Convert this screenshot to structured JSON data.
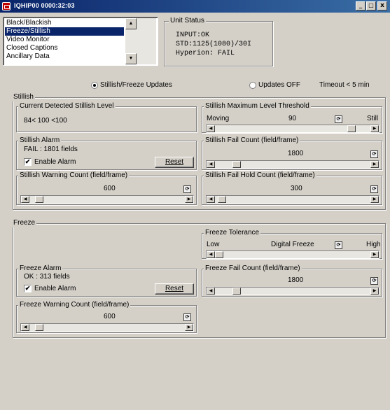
{
  "window": {
    "title": "IQHIP00 0000:32:03",
    "minimize": "_",
    "maximize": "□",
    "close": "x"
  },
  "list": {
    "items": [
      "Black/Blackish",
      "Freeze/Stillish",
      "Video Monitor",
      "Closed Captions",
      "Ancillary Data"
    ],
    "selected_index": 1
  },
  "unit_status": {
    "label": "Unit Status",
    "lines": [
      "INPUT:OK",
      "STD:1125(1080)/30I",
      "Hyperion: FAIL"
    ]
  },
  "updates": {
    "option_on": "Stillish/Freeze Updates",
    "option_off": "Updates OFF",
    "selected": "Stillish/Freeze Updates",
    "timeout": "Timeout < 5 min"
  },
  "stillish": {
    "label": "Stillish",
    "current_level": {
      "label": "Current Detected Stillish Level",
      "value": "84< 100 <100"
    },
    "max_threshold": {
      "label": "Stillish  Maximum Level Threshold",
      "left": "Moving",
      "value": "90",
      "right": "Still",
      "slider_fraction": 0.9
    },
    "alarm": {
      "label": "Stillish Alarm",
      "status": "FAIL : 1801 fields",
      "enable_label": "Enable Alarm",
      "enabled": true,
      "reset_label": "Reset"
    },
    "fail_count": {
      "label": "Stillish Fail Count (field/frame)",
      "value": "1800",
      "slider_fraction": 0.12
    },
    "warning_count": {
      "label": "Stillish Warning Count (field/frame)",
      "value": "600",
      "slider_fraction": 0.04
    },
    "fail_hold_count": {
      "label": "Stillish Fail Hold Count (field/frame)",
      "value": "300",
      "slider_fraction": 0.02
    }
  },
  "freeze": {
    "label": "Freeze",
    "tolerance": {
      "label": "Freeze Tolerance",
      "left": "Low",
      "middle": "Digital Freeze",
      "right": "High",
      "slider_fraction": 0.0
    },
    "alarm": {
      "label": "Freeze Alarm",
      "status": "OK : 313 fields",
      "enable_label": "Enable Alarm",
      "enabled": true,
      "reset_label": "Reset"
    },
    "fail_count": {
      "label": "Freeze Fail Count (field/frame)",
      "value": "1800",
      "slider_fraction": 0.12
    },
    "warning_count": {
      "label": "Freeze Warning Count (field/frame)",
      "value": "600",
      "slider_fraction": 0.04
    }
  },
  "icons": {
    "reset_value": "reset-value-icon",
    "check": "✔",
    "arrow_left": "◀",
    "arrow_right": "▶",
    "arrow_up": "▲",
    "arrow_down": "▼"
  },
  "colors": {
    "title_bar": "#0a246a",
    "selection": "#0a246a",
    "face": "#d4d0c8"
  }
}
